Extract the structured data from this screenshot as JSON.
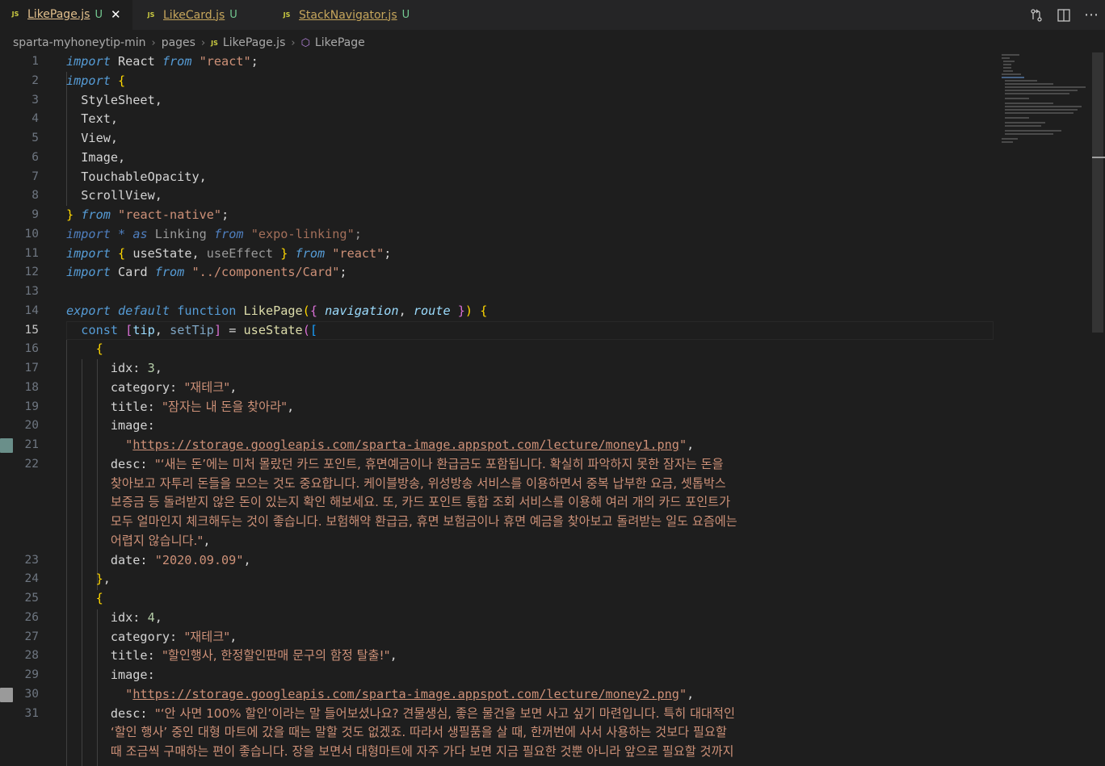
{
  "tabs": [
    {
      "label": "LikePage.js",
      "status": "U",
      "active": true
    },
    {
      "label": "LikeCard.js",
      "status": "U",
      "active": false
    },
    {
      "label": "StackNavigator.js",
      "status": "U",
      "active": false
    }
  ],
  "tab_icons": [
    "source-control-icon",
    "split-editor-icon",
    "more-actions-icon"
  ],
  "breadcrumb": {
    "project": "sparta-myhoneytip-min",
    "folder": "pages",
    "file": "LikePage.js",
    "symbol": "LikePage"
  },
  "editor": {
    "current_line": 15,
    "line_numbers": [
      "1",
      "2",
      "3",
      "4",
      "5",
      "6",
      "7",
      "8",
      "9",
      "10",
      "11",
      "12",
      "13",
      "14",
      "15",
      "16",
      "17",
      "18",
      "19",
      "20",
      "21",
      "22",
      "23",
      "24",
      "25",
      "26",
      "27",
      "28",
      "29",
      "30",
      "31"
    ],
    "strings": {
      "react": "\"react\"",
      "react_native": "\"react-native\"",
      "expo_linking": "\"expo-linking\"",
      "components_card": "\"../components/Card\"",
      "cat1": "\"재테크\"",
      "title1": "\"잠자는 내 돈을 찾아라\"",
      "url1": "https://storage.googleapis.com/sparta-image.appspot.com/lecture/money1.png",
      "desc1_l1": "\"‘새는 돈’에는 미처 몰랐던 카드 포인트, 휴면예금이나 환급금도 포함됩니다. 확실히 파악하지 못한 잠자는 돈을",
      "desc1_l2": "찾아보고 자투리 돈들을 모으는 것도 중요합니다. 케이블방송, 위성방송 서비스를 이용하면서 중복 납부한 요금, 셋톱박스",
      "desc1_l3": "보증금 등 돌려받지 않은 돈이 있는지 확인 해보세요. 또, 카드 포인트 통합 조회 서비스를 이용해 여러 개의 카드 포인트가",
      "desc1_l4": "모두 얼마인지 체크해두는 것이 좋습니다. 보험해약 환급금, 휴면 보험금이나 휴면 예금을 찾아보고 돌려받는 일도 요즘에는",
      "desc1_l5": "어렵지 않습니다.\"",
      "date1": "\"2020.09.09\"",
      "cat2": "\"재테크\"",
      "title2": "\"할인행사, 한정할인판매 문구의 함정 탈출!\"",
      "url2": "https://storage.googleapis.com/sparta-image.appspot.com/lecture/money2.png",
      "desc2_l1": "\"‘안 사면 100% 할인’이라는 말 들어보셨나요? 견물생심, 좋은 물건을 보면 사고 싶기 마련입니다. 특히 대대적인",
      "desc2_l2": "‘할인 행사’ 중인 대형 마트에 갔을 때는 말할 것도 없겠죠. 따라서 생필품을 살 때, 한꺼번에 사서 사용하는 것보다 필요할",
      "desc2_l3": "때 조금씩 구매하는 편이 좋습니다. 장을 보면서 대형마트에 자주 가다 보면 지금 필요한 것뿐 아니라 앞으로 필요할 것까지"
    },
    "numbers": {
      "idx1": "3",
      "idx2": "4"
    }
  },
  "colors": {
    "background": "#1e1e1e",
    "tabbar": "#252526",
    "keyword": "#569cd6",
    "string": "#ce9178",
    "function": "#dcdcaa",
    "number": "#b5cea8",
    "untracked": "#73c991"
  }
}
